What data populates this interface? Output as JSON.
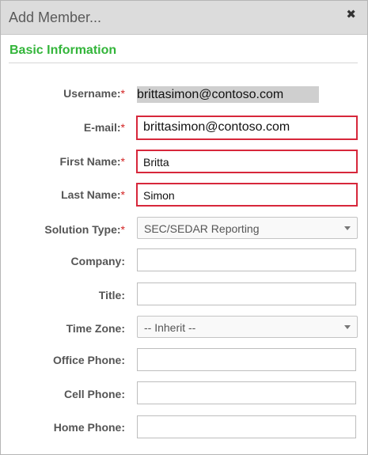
{
  "dialog": {
    "title": "Add Member...",
    "close_glyph": "✖"
  },
  "section": {
    "title": "Basic Information"
  },
  "fields": {
    "username": {
      "label": "Username:",
      "required": "*",
      "value": "brittasimon@contoso.com"
    },
    "email": {
      "label": "E-mail:",
      "required": "*",
      "value": "brittasimon@contoso.com"
    },
    "first_name": {
      "label": "First Name:",
      "required": "*",
      "value": "Britta"
    },
    "last_name": {
      "label": "Last Name:",
      "required": "*",
      "value": "Simon"
    },
    "solution_type": {
      "label": "Solution Type:",
      "required": "*",
      "value": "SEC/SEDAR Reporting"
    },
    "company": {
      "label": "Company:",
      "value": ""
    },
    "title": {
      "label": "Title:",
      "value": ""
    },
    "time_zone": {
      "label": "Time Zone:",
      "value": "-- Inherit --"
    },
    "office_phone": {
      "label": "Office Phone:",
      "value": ""
    },
    "cell_phone": {
      "label": "Cell Phone:",
      "value": ""
    },
    "home_phone": {
      "label": "Home Phone:",
      "value": ""
    }
  },
  "colors": {
    "section_title": "#33b53a",
    "required_mark": "#d32222",
    "highlight_border": "#d7273b",
    "titlebar_bg": "#dcdcdc"
  }
}
